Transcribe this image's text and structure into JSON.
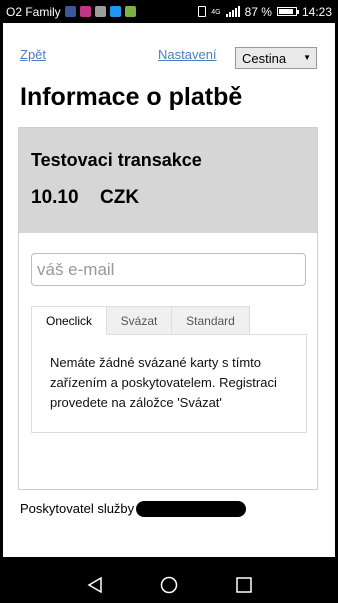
{
  "statusbar": {
    "carrier": "O2 Family",
    "network": "4G",
    "battery": "87 %",
    "battery_level": 0.87,
    "time": "14:23",
    "app_icons": [
      "facebook-icon",
      "instagram-icon",
      "mail-icon",
      "skype-icon",
      "play-icon"
    ],
    "app_icon_colors": [
      "#3b5998",
      "#c13584",
      "#9e9e9e",
      "#2196f3",
      "#7cb342"
    ]
  },
  "nav": {
    "back": "Zpět",
    "settings": "Nastavení",
    "language": "Cestina"
  },
  "title": "Informace o platbě",
  "transaction": {
    "name": "Testovaci transakce",
    "amount": "10.10",
    "currency": "CZK"
  },
  "email": {
    "placeholder": "váš e-mail",
    "value": ""
  },
  "tabs": [
    {
      "label": "Oneclick",
      "active": true
    },
    {
      "label": "Svázat",
      "active": false
    },
    {
      "label": "Standard",
      "active": false
    }
  ],
  "tab_panel_text": "Nemáte žádné svázané karty s tímto zařízením a poskytovatelem. Registraci provedete na záložce 'Svázat'",
  "footer": {
    "provider_label": "Poskytovatel služby"
  },
  "colors": {
    "link": "#4a7fc0",
    "card_header_bg": "#d6d6d6"
  }
}
